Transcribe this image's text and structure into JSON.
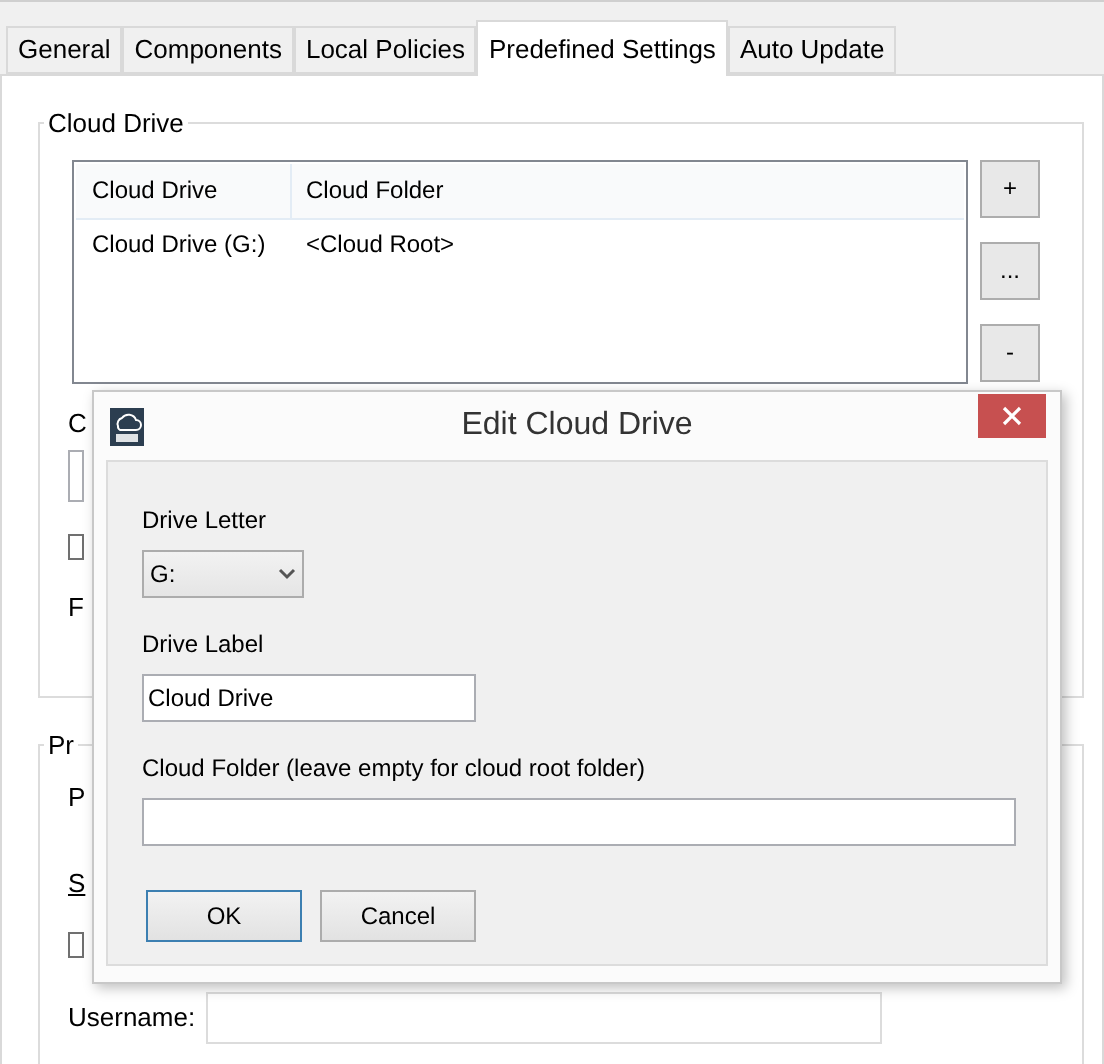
{
  "tabs": [
    {
      "label": "General",
      "selected": false
    },
    {
      "label": "Components",
      "selected": false
    },
    {
      "label": "Local Policies",
      "selected": false
    },
    {
      "label": "Predefined Settings",
      "selected": true
    },
    {
      "label": "Auto Update",
      "selected": false
    }
  ],
  "cloud_drive_group": {
    "title": "Cloud Drive",
    "table": {
      "columns": [
        "Cloud Drive",
        "Cloud Folder"
      ],
      "rows": [
        [
          "Cloud Drive (G:)",
          "<Cloud Root>"
        ]
      ]
    },
    "buttons": [
      "+",
      "...",
      "-"
    ],
    "partial_labels": [
      "C",
      "F"
    ],
    "checkbox": {
      "checked": false
    }
  },
  "second_group": {
    "title": "Pr",
    "partial_labels": [
      "P",
      "S"
    ],
    "checkbox": {
      "checked": false
    },
    "username_label": "Username:"
  },
  "dialog": {
    "title": "Edit Cloud Drive",
    "drive_letter": {
      "label": "Drive Letter",
      "value": "G:"
    },
    "drive_label": {
      "label": "Drive Label",
      "value": "Cloud Drive"
    },
    "cloud_folder": {
      "label": "Cloud Folder (leave empty for cloud root folder)"
    },
    "buttons": [
      {
        "label": "OK",
        "default": true
      },
      {
        "label": "Cancel",
        "default": false
      }
    ]
  }
}
